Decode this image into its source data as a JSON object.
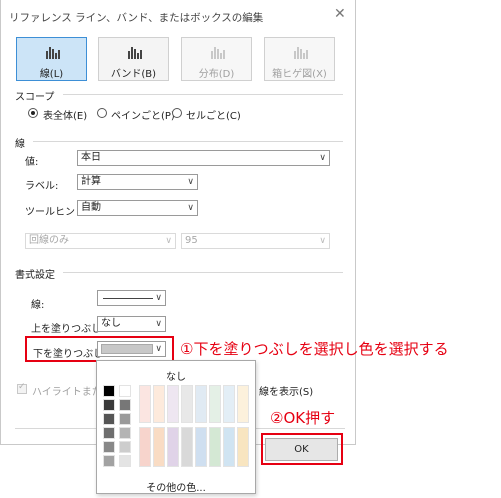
{
  "dialog": {
    "title": "リファレンス ライン、バンド、またはボックスの編集",
    "close_glyph": "✕"
  },
  "mark_types": [
    {
      "label": "線(L)",
      "icon": "reference-line-icon",
      "state": "selected"
    },
    {
      "label": "バンド(B)",
      "icon": "reference-band-icon",
      "state": "normal"
    },
    {
      "label": "分布(D)",
      "icon": "distribution-icon",
      "state": "disabled"
    },
    {
      "label": "箱ヒゲ図(X)",
      "icon": "box-plot-icon",
      "state": "disabled"
    }
  ],
  "scope": {
    "heading": "スコープ",
    "options": [
      {
        "label": "表全体(E)",
        "checked": true
      },
      {
        "label": "ペインごと(P)",
        "checked": false
      },
      {
        "label": "セルごと(C)",
        "checked": false
      }
    ]
  },
  "line": {
    "heading": "線",
    "value_label": "値:",
    "value": "本日",
    "label_label": "ラベル:",
    "label_value": "計算",
    "tooltip_label": "ツールヒント:",
    "tooltip_value": "自動",
    "line_only": "回線のみ",
    "percent": "95"
  },
  "format": {
    "heading": "書式設定",
    "line_label": "線:",
    "fill_above_label": "上を塗りつぶし:",
    "fill_above_value": "なし",
    "fill_below_label": "下を塗りつぶし:"
  },
  "highlight": {
    "label_start": "ハイライトまたは",
    "label_end": "線を表示(S)",
    "checked": true
  },
  "buttons": {
    "ok": "OK"
  },
  "color_popup": {
    "none_label": "なし",
    "more_colors": "その他の色...",
    "grays": [
      "#000000",
      "#ffffff",
      "#3a3a3a",
      "#777777",
      "#555555",
      "#9a9a9a",
      "#6e6e6e",
      "#b4b4b4",
      "#888888",
      "#cdcdcd",
      "#a2a2a2",
      "#e4e4e4"
    ],
    "light_row": [
      "#fbe5e1",
      "#fdeadc",
      "#eee6f1",
      "#e8e8e8",
      "#e0eaf3",
      "#e4f0e6",
      "#e3eef6",
      "#fcf1dc"
    ],
    "mid_row": [
      "#f7d4cc",
      "#f9dcc4",
      "#e0d3e8",
      "#d9d9d9",
      "#cfdff0",
      "#d4e8d4",
      "#d0e4f2",
      "#f8e5c0"
    ]
  },
  "annotations": {
    "step1": "①下を塗りつぶしを選択し色を選択する",
    "step2": "②OK押す",
    "accent": "#e60012"
  }
}
